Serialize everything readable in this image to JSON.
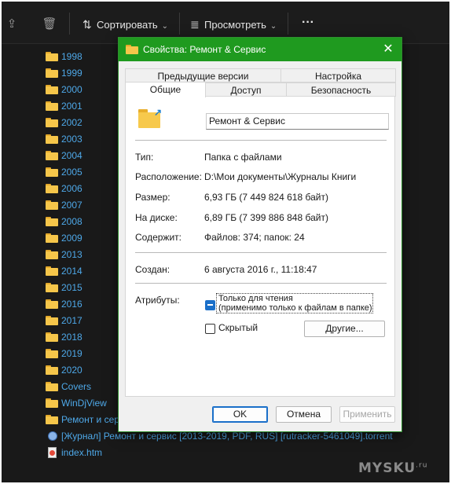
{
  "toolbar": {
    "sort_label": "Сортировать",
    "view_label": "Просмотреть",
    "icons": [
      "share-icon",
      "trash-icon",
      "sort-icon",
      "view-icon",
      "more-icon"
    ]
  },
  "files": [
    {
      "name": "1998",
      "type": "folder"
    },
    {
      "name": "1999",
      "type": "folder"
    },
    {
      "name": "2000",
      "type": "folder"
    },
    {
      "name": "2001",
      "type": "folder"
    },
    {
      "name": "2002",
      "type": "folder"
    },
    {
      "name": "2003",
      "type": "folder"
    },
    {
      "name": "2004",
      "type": "folder"
    },
    {
      "name": "2005",
      "type": "folder"
    },
    {
      "name": "2006",
      "type": "folder"
    },
    {
      "name": "2007",
      "type": "folder"
    },
    {
      "name": "2008",
      "type": "folder"
    },
    {
      "name": "2009",
      "type": "folder"
    },
    {
      "name": "2013",
      "type": "folder"
    },
    {
      "name": "2014",
      "type": "folder"
    },
    {
      "name": "2015",
      "type": "folder"
    },
    {
      "name": "2016",
      "type": "folder"
    },
    {
      "name": "2017",
      "type": "folder"
    },
    {
      "name": "2018",
      "type": "folder"
    },
    {
      "name": "2019",
      "type": "folder"
    },
    {
      "name": "2020",
      "type": "folder"
    },
    {
      "name": "Covers",
      "type": "folder"
    },
    {
      "name": "WinDjView",
      "type": "folder"
    },
    {
      "name": "Ремонт и сер",
      "type": "folder"
    },
    {
      "name": "[Журнал] Ремонт и сервис [2013-2019, PDF, RUS] [rutracker-5461049].torrent",
      "type": "torrent"
    },
    {
      "name": "index.htm",
      "type": "html"
    }
  ],
  "dialog": {
    "title": "Свойства: Ремонт & Сервис",
    "tabs_row1": [
      "Предыдущие версии",
      "Настройка"
    ],
    "tabs_row2": [
      "Общие",
      "Доступ",
      "Безопасность"
    ],
    "active_tab": "Общие",
    "name_value": "Ремонт & Сервис",
    "props": {
      "type_label": "Тип:",
      "type_value": "Папка с файлами",
      "location_label": "Расположение:",
      "location_value": "D:\\Мои документы\\Журналы Книги",
      "size_label": "Размер:",
      "size_value": "6,93 ГБ (7 449 824 618 байт)",
      "disk_label": "На диске:",
      "disk_value": "6,89 ГБ (7 399 886 848 байт)",
      "contains_label": "Содержит:",
      "contains_value": "Файлов: 374; папок: 24",
      "created_label": "Создан:",
      "created_value": "6 августа 2016 г., 11:18:47",
      "attributes_label": "Атрибуты:"
    },
    "attributes": {
      "readonly_line1": "Только для чтения",
      "readonly_line2": "(применимо только к файлам в папке)",
      "readonly_state": "indeterminate",
      "hidden_label": "Скрытый",
      "hidden_checked": false,
      "other_button": "Другие..."
    },
    "buttons": {
      "ok": "OK",
      "cancel": "Отмена",
      "apply": "Применить"
    },
    "accent_color": "#1f9a1f"
  },
  "watermark": {
    "text": "MYSKU",
    "suffix": ".ru"
  }
}
